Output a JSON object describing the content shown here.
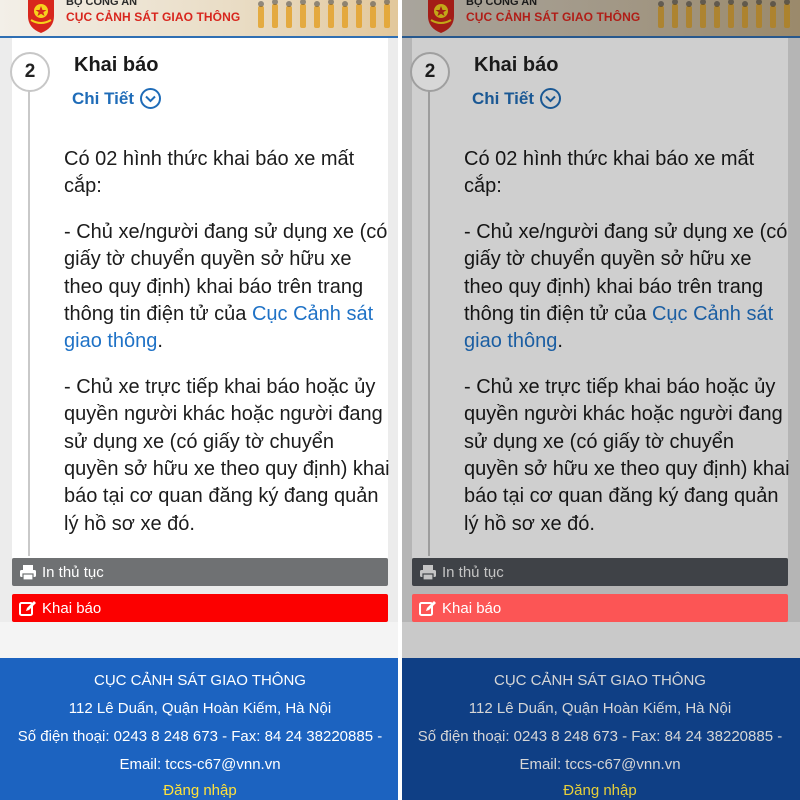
{
  "header": {
    "ministry": "BỘ CÔNG AN",
    "agency": "CỤC CẢNH SÁT GIAO THÔNG"
  },
  "step": {
    "number": "2",
    "title": "Khai báo",
    "detail_label": "Chi Tiết"
  },
  "content": {
    "intro": "Có 02 hình thức khai báo xe mất cắp:",
    "item1_text": "- Chủ xe/người đang sử dụng xe (có giấy tờ chuyển quyền sở hữu xe theo quy định) khai báo trên trang thông tin điện tử của ",
    "item1_link": "Cục Cảnh sát giao thông",
    "item1_end": ".",
    "item2": "- Chủ xe trực tiếp khai báo hoặc ủy quyền người khác hoặc người đang sử dụng xe (có giấy tờ chuyển quyền sở hữu xe theo quy định) khai báo tại cơ quan đăng ký đang quản lý hồ sơ xe đó."
  },
  "buttons": {
    "print_label": "In thủ tục",
    "declare_label": "Khai báo"
  },
  "footer": {
    "org": "CỤC CẢNH SÁT GIAO THÔNG",
    "address": "112 Lê Duẩn, Quận Hoàn Kiếm, Hà Nội",
    "phone": "Số điện thoại: 0243 8 248 673 - Fax: 84 24 38220885 -",
    "email": "Email: tccs-c67@vnn.vn",
    "login": "Đăng nhập"
  },
  "icons": {
    "printer": "printer-icon",
    "edit": "edit-icon",
    "chevron": "chevron-down-circle-icon"
  },
  "colors": {
    "accent_blue": "#1f6cb8",
    "declare_red": "#fc0000",
    "footer_blue": "#1c63c0",
    "login_yellow": "#ffe23a"
  }
}
